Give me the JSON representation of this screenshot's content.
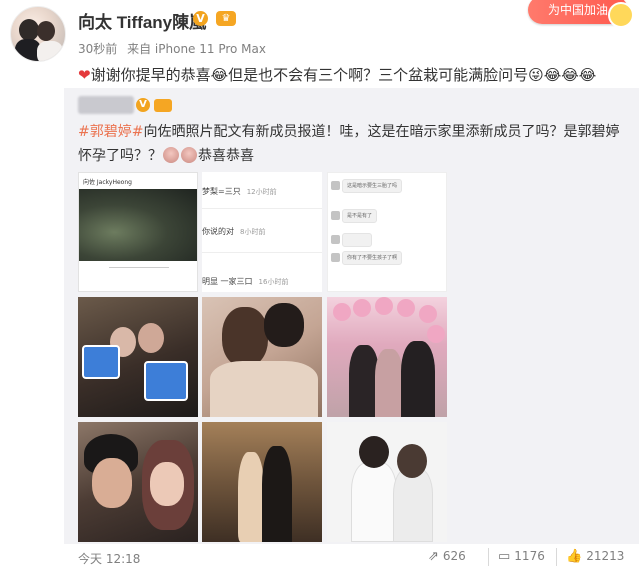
{
  "header": {
    "username": "向太 Tiffany陳嵐",
    "verified_badge": "V",
    "time": "30秒前",
    "source": "来自 iPhone 11 Pro Max",
    "sticker_text": "为中国加油"
  },
  "post": {
    "heart": "❤",
    "text": "谢谢你提早的恭喜😂但是也不会有三个啊？三个盆栽可能满脸问号😜😂😂😂"
  },
  "repost": {
    "verified_badge": "V",
    "hashtag": "#郭碧婷#",
    "text": "向佐晒照片配文有新成员报道！哇，这是在暗示家里添新成员了吗？是郭碧婷怀孕了吗？？",
    "tail": "恭喜恭喜",
    "screenshots": {
      "ig_header": "向佐 JackyHeong",
      "comments": [
        {
          "text": "梦梨=三只",
          "time": "12小时前"
        },
        {
          "text": "你说的对",
          "time": "8小时前"
        },
        {
          "text": "明显 一家三口",
          "time": "16小时前"
        }
      ],
      "chat_lines": [
        "这是暗示要生三胎了吗",
        "是不是有了",
        "",
        "你有了不要生孩子了啊"
      ]
    }
  },
  "footer": {
    "time": "今天 12:18",
    "reposts": "626",
    "comments": "1176",
    "likes": "21213"
  }
}
